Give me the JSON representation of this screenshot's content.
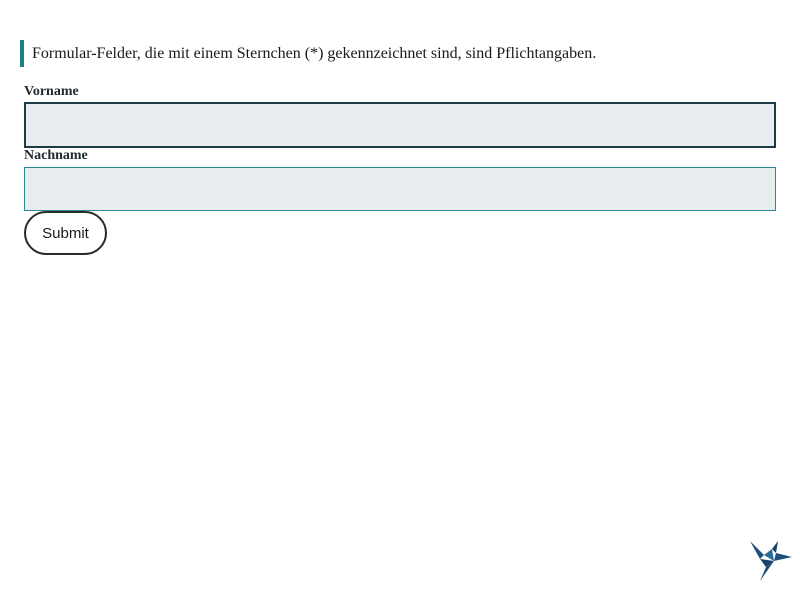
{
  "notice": {
    "text": "Formular-Felder, die mit einem Sternchen (*) gekennzeichnet sind, sind Pflichtangaben."
  },
  "form": {
    "fields": [
      {
        "label": "Vorname",
        "value": "",
        "placeholder": ""
      },
      {
        "label": "Nachname",
        "value": "",
        "placeholder": ""
      }
    ],
    "submit_label": "Submit"
  },
  "icons": {
    "corner_logo": "hummingbird-logo-icon"
  },
  "colors": {
    "accent": "#1b7f84",
    "input_background": "#e8edf0",
    "logo": "#1d4f7a"
  }
}
